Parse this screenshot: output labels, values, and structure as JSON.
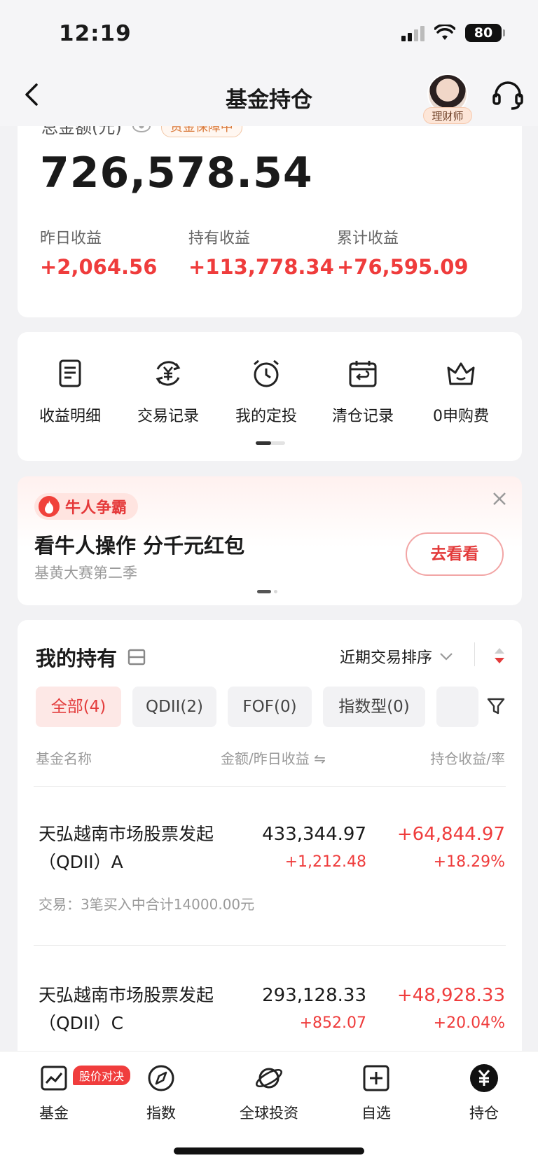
{
  "status_bar": {
    "time": "12:19",
    "battery": "80"
  },
  "nav": {
    "title": "基金持仓",
    "advisor_label": "理财师"
  },
  "summary": {
    "total_label": "总金额(元)",
    "guarantee_badge": "资金保障中",
    "total_amount": "726,578.54",
    "stats": [
      {
        "label": "昨日收益",
        "value": "+2,064.56"
      },
      {
        "label": "持有收益",
        "value": "+113,778.34"
      },
      {
        "label": "累计收益",
        "value": "+76,595.09"
      }
    ]
  },
  "menu": {
    "items": [
      {
        "label": "收益明细",
        "icon": "document-icon"
      },
      {
        "label": "交易记录",
        "icon": "yuan-exchange-icon"
      },
      {
        "label": "我的定投",
        "icon": "alarm-clock-icon"
      },
      {
        "label": "清仓记录",
        "icon": "calendar-return-icon"
      },
      {
        "label": "0申购费",
        "icon": "crown-icon"
      }
    ]
  },
  "promo": {
    "tag": "牛人争霸",
    "title": "看牛人操作 分千元红包",
    "subtitle": "基黄大赛第二季",
    "button": "去看看"
  },
  "holdings": {
    "title": "我的持有",
    "sort_label": "近期交易排序",
    "chips": [
      {
        "label": "全部(4)",
        "active": true
      },
      {
        "label": "QDII(2)",
        "active": false
      },
      {
        "label": "FOF(0)",
        "active": false
      },
      {
        "label": "指数型(0)",
        "active": false
      }
    ],
    "columns": {
      "name": "基金名称",
      "amount": "金额/昨日收益 ⇋",
      "profit": "持仓收益/率"
    },
    "funds": [
      {
        "name": "天弘越南市场股票发起（QDII）A",
        "amount": "433,344.97",
        "daily": "+1,212.48",
        "profit": "+64,844.97",
        "rate": "+18.29%",
        "trade": "交易：3笔买入中合计14000.00元"
      },
      {
        "name": "天弘越南市场股票发起（QDII）C",
        "amount": "293,128.33",
        "daily": "+852.07",
        "profit": "+48,928.33",
        "rate": "+20.04%"
      }
    ]
  },
  "tabs": [
    {
      "label": "基金",
      "icon": "fund-chart-icon",
      "badge": "股价对决"
    },
    {
      "label": "指数",
      "icon": "compass-icon"
    },
    {
      "label": "全球投资",
      "icon": "planet-icon"
    },
    {
      "label": "自选",
      "icon": "add-square-icon"
    },
    {
      "label": "持仓",
      "icon": "yuan-circle-icon",
      "active": true
    }
  ],
  "colors": {
    "profit_red": "#ef3c3c",
    "accent_red": "#e33b3b"
  }
}
